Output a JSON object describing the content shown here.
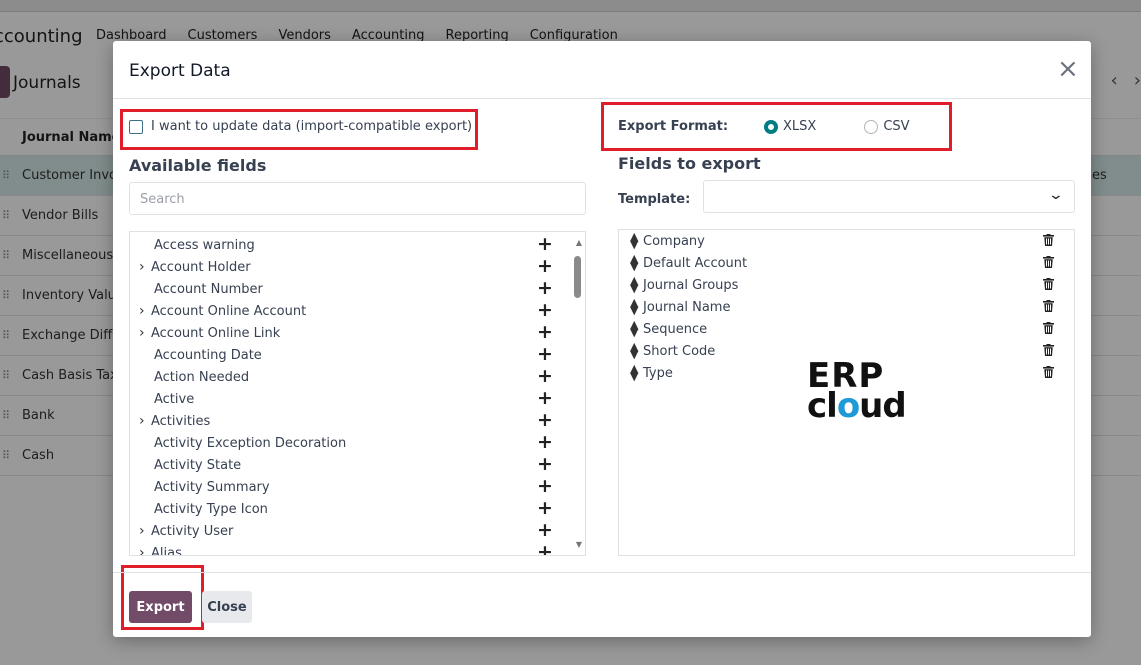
{
  "background": {
    "app_name": "ccounting",
    "menu": [
      "Dashboard",
      "Customers",
      "Vendors",
      "Accounting",
      "Reporting",
      "Configuration"
    ],
    "breadcrumb": "Journals",
    "list_header": "Journal Name",
    "rows": [
      "Customer Invo",
      "Vendor Bills",
      "Miscellaneous",
      "Inventory Valu",
      "Exchange Diffe",
      "Cash Basis Taxe",
      "Bank",
      "Cash"
    ],
    "row_tail_text": "es",
    "pager_prev": "‹",
    "pager_next": "›"
  },
  "modal": {
    "title": "Export Data",
    "close_icon": "close-icon",
    "import_compatible_label": "I want to update data (import-compatible export)",
    "import_compatible_checked": false,
    "export_format_label": "Export Format:",
    "formats": [
      {
        "label": "XLSX",
        "selected": true
      },
      {
        "label": "CSV",
        "selected": false
      }
    ],
    "available_fields_title": "Available fields",
    "search_placeholder": "Search",
    "fields_to_export_title": "Fields to export",
    "template_label": "Template:",
    "template_value": "",
    "available_fields": [
      {
        "label": "Access warning",
        "expandable": false
      },
      {
        "label": "Account Holder",
        "expandable": true
      },
      {
        "label": "Account Number",
        "expandable": false
      },
      {
        "label": "Account Online Account",
        "expandable": true
      },
      {
        "label": "Account Online Link",
        "expandable": true
      },
      {
        "label": "Accounting Date",
        "expandable": false
      },
      {
        "label": "Action Needed",
        "expandable": false
      },
      {
        "label": "Active",
        "expandable": false
      },
      {
        "label": "Activities",
        "expandable": true
      },
      {
        "label": "Activity Exception Decoration",
        "expandable": false
      },
      {
        "label": "Activity State",
        "expandable": false
      },
      {
        "label": "Activity Summary",
        "expandable": false
      },
      {
        "label": "Activity Type Icon",
        "expandable": false
      },
      {
        "label": "Activity User",
        "expandable": true
      },
      {
        "label": "Alias",
        "expandable": true
      }
    ],
    "export_fields": [
      "Company",
      "Default Account",
      "Journal Groups",
      "Journal Name",
      "Sequence",
      "Short Code",
      "Type"
    ],
    "watermark_line1": "ERP",
    "watermark_line2_a": "cl",
    "watermark_line2_o": "o",
    "watermark_line2_b": "ud",
    "export_button": "Export",
    "close_button": "Close"
  },
  "colors": {
    "primary": "#714B67",
    "radio_accent": "#017e84",
    "highlight_box": "#e01e2b"
  }
}
